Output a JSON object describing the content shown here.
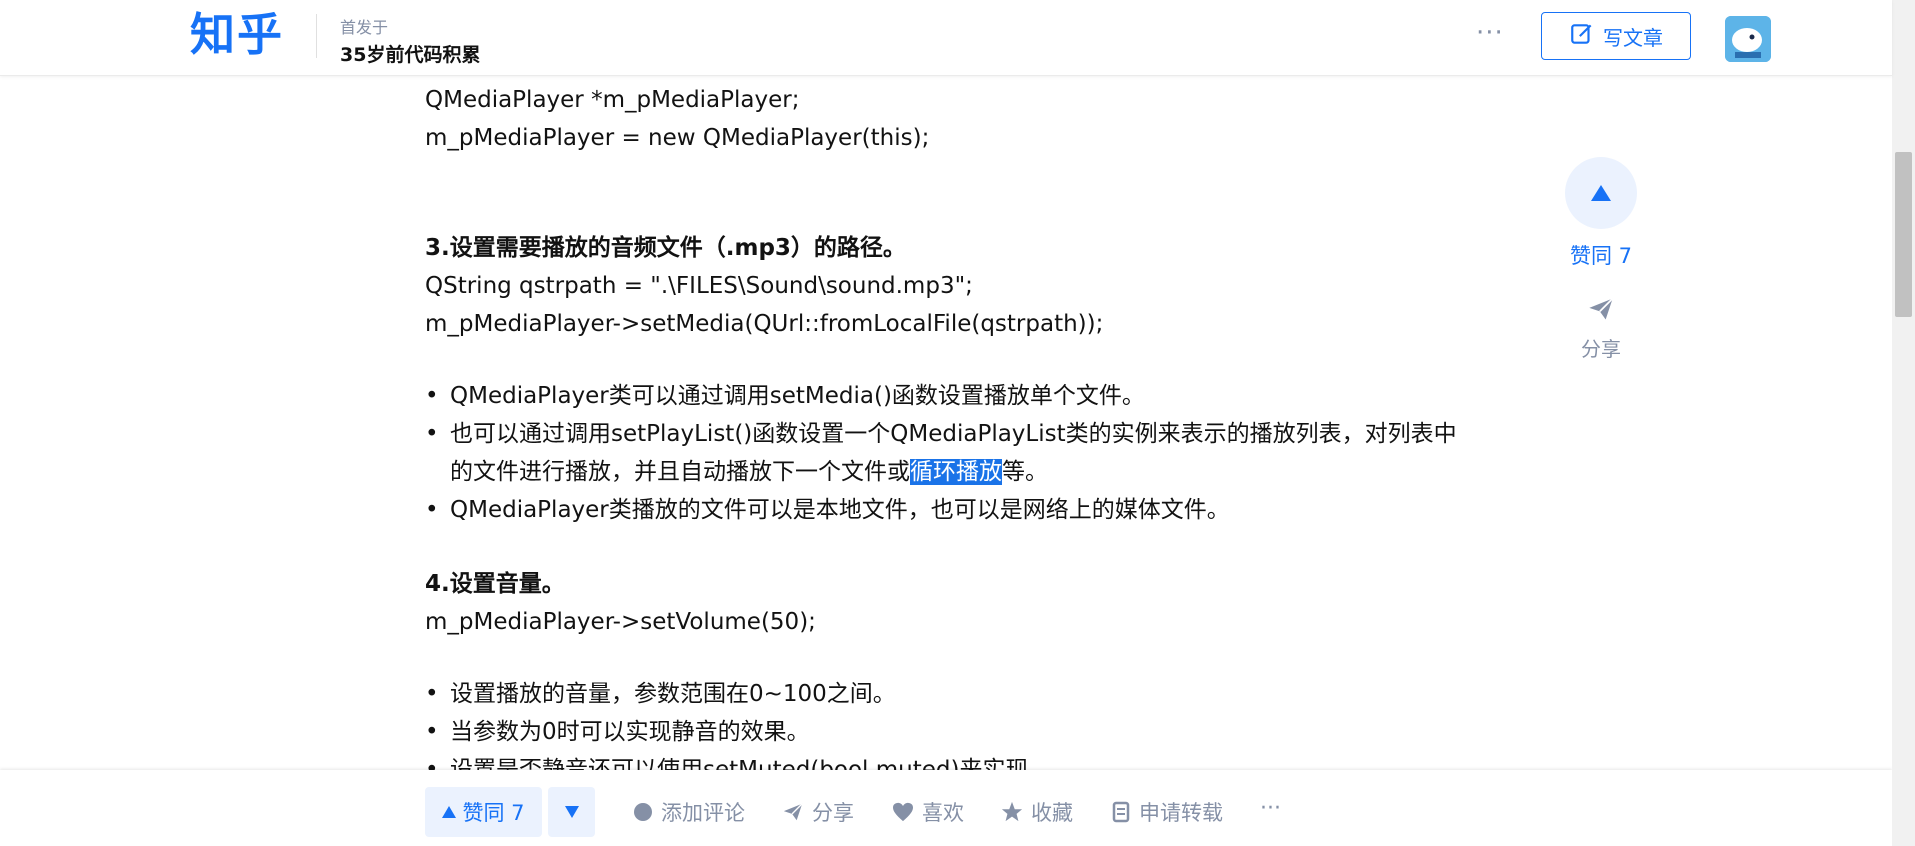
{
  "header": {
    "logo": "知乎",
    "published_label": "首发于",
    "column_name": "35岁前代码积累",
    "write_button": "写文章"
  },
  "article": {
    "line1": "QMediaPlayer *m_pMediaPlayer;",
    "line2": "m_pMediaPlayer = new QMediaPlayer(this);",
    "heading3": "3.设置需要播放的音频文件（.mp3）的路径。",
    "code3a": "QString qstrpath = \".\\FILES\\Sound\\sound.mp3\";",
    "code3b": "m_pMediaPlayer->setMedia(QUrl::fromLocalFile(qstrpath));",
    "bullet3_1": "QMediaPlayer类可以通过调用setMedia()函数设置播放单个文件。",
    "bullet3_2_part1": "也可以通过调用setPlayList()函数设置一个QMediaPlayList类的实例来表示的播放列表，对列表中的文件进行播放，并且自动播放下一个文件或",
    "bullet3_2_highlight": "循环播放",
    "bullet3_2_part2": "等。",
    "bullet3_3": "QMediaPlayer类播放的文件可以是本地文件，也可以是网络上的媒体文件。",
    "heading4": "4.设置音量。",
    "code4": "m_pMediaPlayer->setVolume(50);",
    "bullet4_1": "设置播放的音量，参数范围在0~100之间。",
    "bullet4_2": "当参数为0时可以实现静音的效果。",
    "bullet4_3": "设置是否静音还可以使用setMuted(bool muted)来实现。"
  },
  "side_actions": {
    "vote_label": "赞同 7",
    "share_label": "分享"
  },
  "bottom_bar": {
    "vote_up": "赞同 7",
    "comment": "添加评论",
    "share": "分享",
    "like": "喜欢",
    "collect": "收藏",
    "reprint": "申请转载"
  },
  "colors": {
    "brand": "#1772f6",
    "vote_bg": "#ebf2fe",
    "muted": "#8590a6",
    "highlight": "#1a73e8"
  }
}
